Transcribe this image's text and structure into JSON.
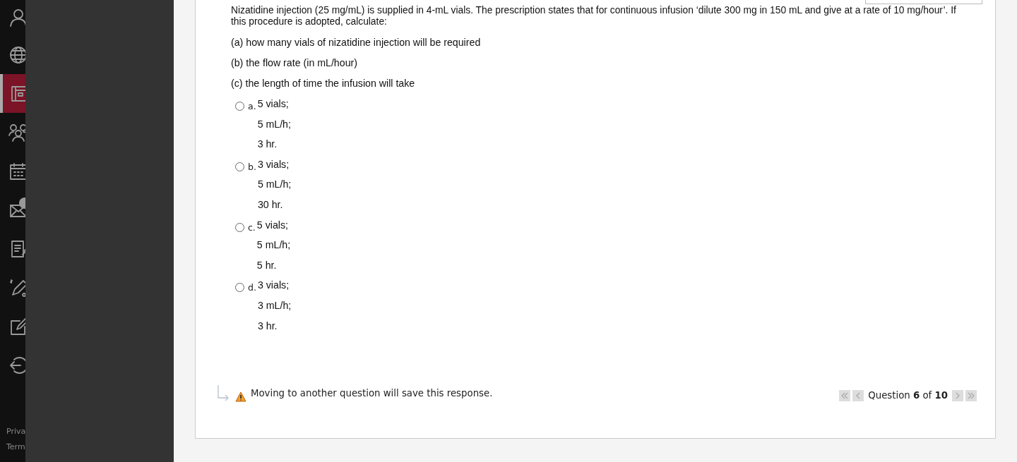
{
  "sidebar": {
    "items": [
      {
        "kind": "user",
        "selected": false
      },
      {
        "kind": "globe",
        "selected": false
      },
      {
        "kind": "courses",
        "selected": true
      },
      {
        "kind": "people",
        "selected": false
      },
      {
        "kind": "calendar",
        "selected": false
      },
      {
        "kind": "mail",
        "selected": false,
        "badge": true
      },
      {
        "kind": "notes",
        "selected": false
      },
      {
        "kind": "tools",
        "selected": false
      },
      {
        "kind": "edit",
        "selected": false
      },
      {
        "kind": "logout",
        "selected": false
      }
    ],
    "footer_links": [
      "Priva",
      "Term"
    ]
  },
  "question": {
    "text": "Nizatidine injection (25 mg/mL) is supplied in 4-mL vials. The prescription states that for continuous infusion ‘dilute 300 mg in 150 mL and give at a rate of 10 mg/hour’. If this procedure is adopted, calculate:",
    "parts": [
      "(a) how many vials of nizatidine injection will be required",
      "(b) the flow rate (in mL/hour)",
      "(c) the length of time the infusion will take"
    ],
    "options": [
      {
        "letter": "a.",
        "lines": [
          "5 vials;",
          "5 mL/h;",
          "3 hr."
        ],
        "selected": false
      },
      {
        "letter": "b.",
        "lines": [
          "3 vials;",
          "5 mL/h;",
          "30 hr."
        ],
        "selected": false
      },
      {
        "letter": "c.",
        "lines": [
          "5 vials;",
          "5 mL/h;",
          "5 hr."
        ],
        "selected": false
      },
      {
        "letter": "d.",
        "lines": [
          "3 vials;",
          "3 mL/h;",
          "3 hr."
        ],
        "selected": false
      }
    ],
    "notice": "Moving to another question will save this response.",
    "pager": {
      "label": "Question **6** of **10**"
    }
  }
}
